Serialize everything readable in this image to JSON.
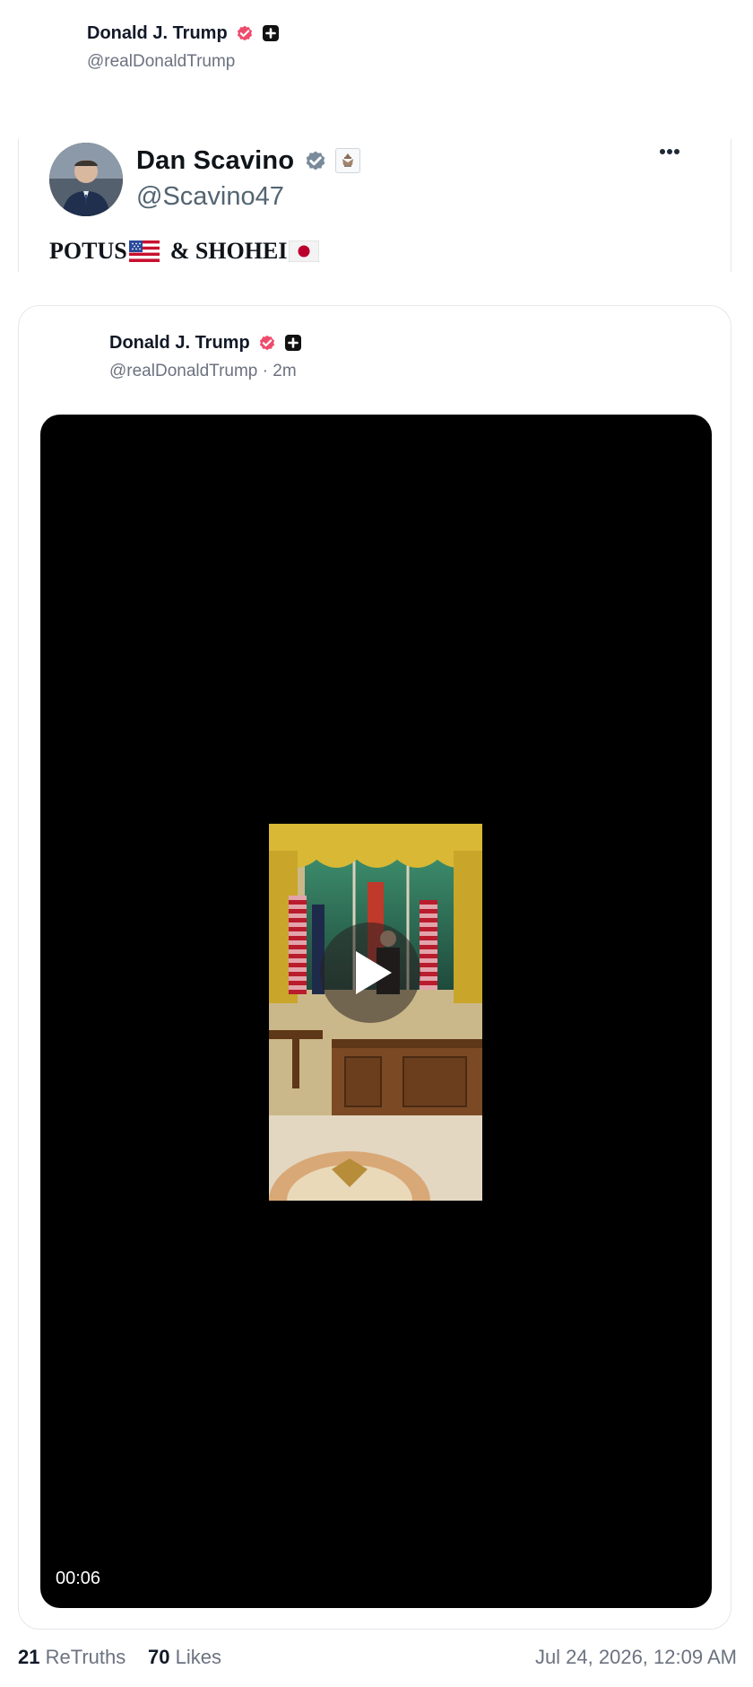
{
  "top_header": {
    "name": "Donald J. Trump",
    "handle": "@realDonaldTrump",
    "verified_icon": "verified-pink-badge-icon",
    "plus_icon": "plus-square-icon"
  },
  "quoted_post": {
    "name": "Dan Scavino",
    "handle": "@Scavino47",
    "text_part1": "POTUS",
    "text_part2": "& SHOHEI",
    "flags": [
      "us-flag-icon",
      "japan-flag-icon"
    ],
    "verified_icon": "verified-gray-badge-icon",
    "seal_icon": "official-seal-icon",
    "more_icon": "more-dots-icon"
  },
  "post": {
    "name": "Donald J. Trump",
    "handle": "@realDonaldTrump",
    "separator": "·",
    "time_ago": "2m",
    "video": {
      "duration": "00:06",
      "play_icon": "play-icon"
    }
  },
  "stats": {
    "retruths_count": "21",
    "retruths_label": "ReTruths",
    "likes_count": "70",
    "likes_label": "Likes",
    "timestamp": "Jul 24, 2026, 12:09 AM"
  },
  "colors": {
    "verified_pink": "#ef4b6c",
    "verified_gray": "#7a8a9a",
    "muted_text": "#6b7280",
    "video_bg": "#000000"
  }
}
